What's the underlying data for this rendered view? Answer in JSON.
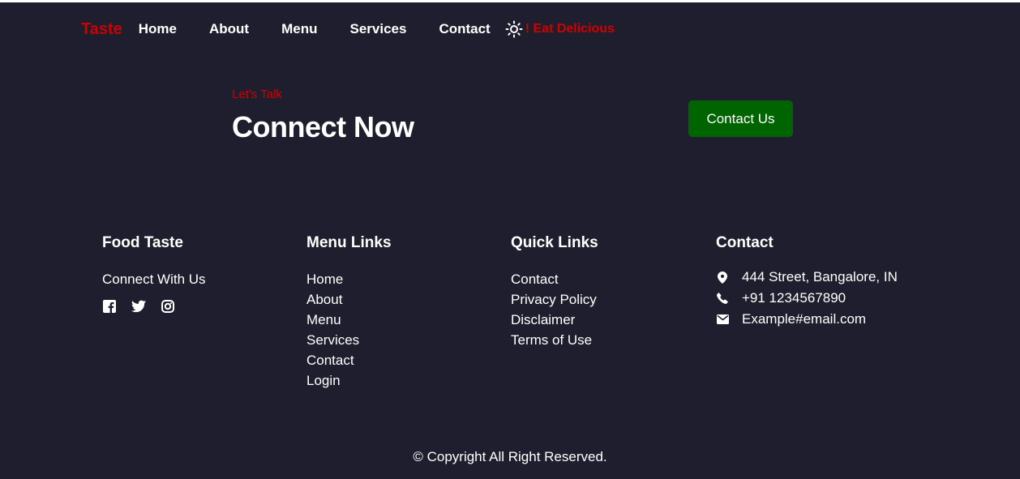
{
  "nav": {
    "brand": "Taste",
    "links": [
      "Home",
      "About",
      "Menu",
      "Services",
      "Contact"
    ],
    "theme_icon": "sun-icon",
    "tagline": "! Eat Delicious"
  },
  "hero": {
    "kicker": "Let's Talk",
    "headline": "Connect Now",
    "cta_label": "Contact Us"
  },
  "footer": {
    "about": {
      "title": "Food Taste",
      "subtitle": "Connect With Us",
      "socials": [
        "facebook-icon",
        "twitter-icon",
        "instagram-icon"
      ]
    },
    "menu_links": {
      "title": "Menu Links",
      "items": [
        "Home",
        "About",
        "Menu",
        "Services",
        "Contact",
        "Login"
      ]
    },
    "quick_links": {
      "title": "Quick Links",
      "items": [
        "Contact",
        "Privacy Policy",
        "Disclaimer",
        "Terms of Use"
      ]
    },
    "contact": {
      "title": "Contact",
      "address": "444 Street, Bangalore, IN",
      "phone": "+91 1234567890",
      "email": "Example#email.com"
    },
    "copyright": "© Copyright All Right Reserved."
  },
  "colors": {
    "background": "#1f1e2e",
    "accent": "#d10000",
    "cta": "#006400",
    "text": "#ffffff"
  }
}
